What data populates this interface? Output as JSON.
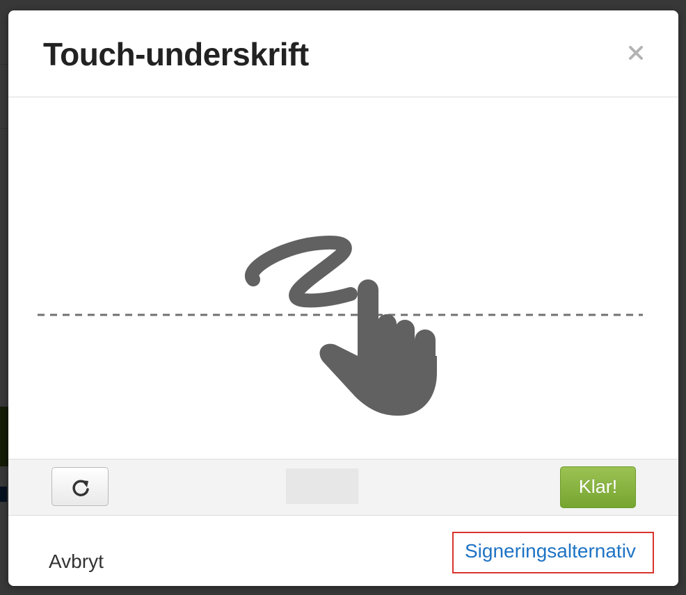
{
  "dialog": {
    "title": "Touch-underskrift",
    "close_icon": "close-icon"
  },
  "signature_pad": {
    "illustration_icon": "finger-draw-signature-icon"
  },
  "toolbar": {
    "reset_icon": "refresh-icon",
    "done_label": "Klar!"
  },
  "footer": {
    "cancel_label": "Avbryt",
    "options_label": "Signeringsalternativ"
  },
  "colors": {
    "done_button": "#86b33f",
    "link": "#1e73c4",
    "highlight_frame": "#d9332b",
    "illustration": "#616161"
  }
}
